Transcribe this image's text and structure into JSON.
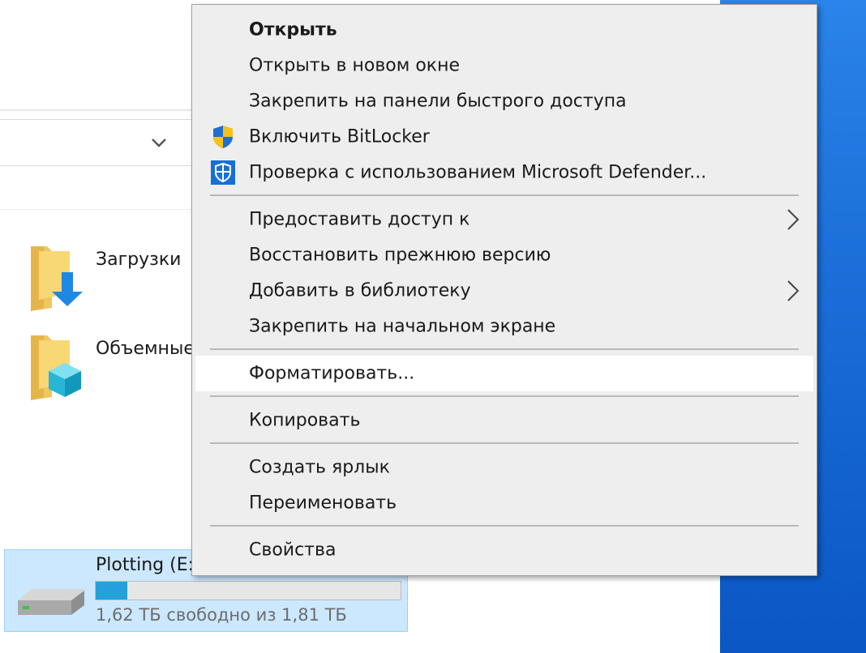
{
  "explorer": {
    "folders": [
      {
        "name": "Загрузки",
        "icon": "downloads-folder-icon"
      },
      {
        "name": "Объемные",
        "icon": "3d-objects-folder-icon"
      }
    ],
    "drive": {
      "name": "Plotting (E:)",
      "free_text": "1,62 ТБ свободно из 1,81 ТБ",
      "used_fraction": 0.105,
      "icon": "hard-drive-icon"
    }
  },
  "context_menu": {
    "items": [
      {
        "label": "Открыть",
        "bold": true
      },
      {
        "label": "Открыть в новом окне"
      },
      {
        "label": "Закрепить на панели быстрого доступа"
      },
      {
        "label": "Включить BitLocker",
        "icon": "shield-icon"
      },
      {
        "label": "Проверка с использованием Microsoft Defender...",
        "icon": "defender-icon"
      },
      {
        "label": "Предоставить доступ к",
        "submenu": true
      },
      {
        "label": "Восстановить прежнюю версию"
      },
      {
        "label": "Добавить в библиотеку",
        "submenu": true
      },
      {
        "label": "Закрепить на начальном экране"
      },
      {
        "label": "Форматировать...",
        "highlighted": true
      },
      {
        "label": "Копировать"
      },
      {
        "label": "Создать ярлык"
      },
      {
        "label": "Переименовать"
      },
      {
        "label": "Свойства"
      }
    ]
  },
  "colors": {
    "desktop_blue": "#0f63cf",
    "drive_selection": "#cce8ff",
    "drive_bar_fill": "#26a0da",
    "menu_background": "#eeeeee",
    "menu_highlight": "#ffffff"
  }
}
